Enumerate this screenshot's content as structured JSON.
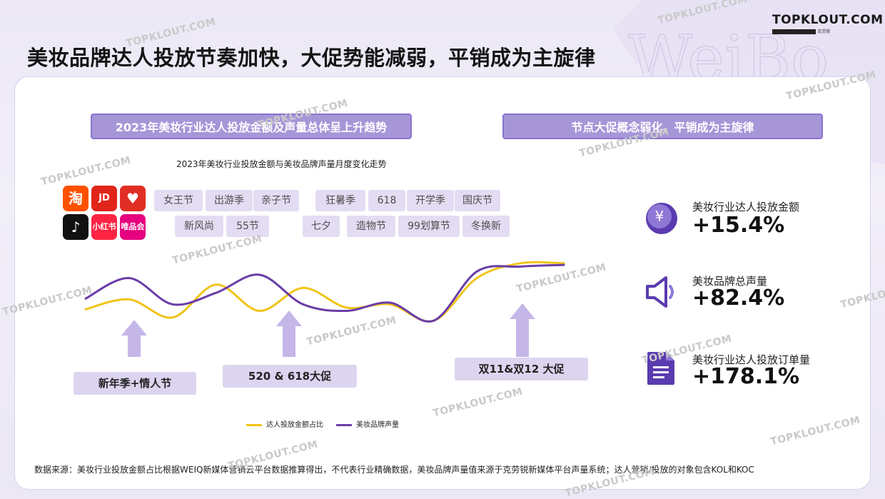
{
  "title": "美妆品牌达人投放节奏加快，大促势能减弱，平销成为主旋律",
  "brand": {
    "name": "TOPKLOUT.COM",
    "tagline": "克劳锐"
  },
  "watermark": "TOPKLOUT.COM",
  "left_banner": "2023年美妆行业达人投放金额及声量总体呈上升趋势",
  "right_banner": "节点大促概念弱化、平销成为主旋律",
  "chart_title": "2023年美妆行业投放金额与美妆品牌声量月度变化走势",
  "apps": [
    {
      "name": "taobao-icon",
      "label": "淘",
      "color": "#ff5000"
    },
    {
      "name": "jd-icon",
      "label": "JD",
      "color": "#e1251b"
    },
    {
      "name": "pinduoduo-icon",
      "label": "♥",
      "color": "#e02e24"
    },
    {
      "name": "douyin-icon",
      "label": "♪",
      "color": "#111111"
    },
    {
      "name": "xiaohongshu-icon",
      "label": "小红书",
      "color": "#ff2442"
    },
    {
      "name": "vipshop-icon",
      "label": "唯品会",
      "color": "#e5007f"
    }
  ],
  "tags_row1": [
    "女王节",
    "出游季",
    "亲子节",
    "狂暑季",
    "618",
    "开学季",
    "国庆节"
  ],
  "tags_row2": [
    "新风尚",
    "55节",
    "七夕",
    "造物节",
    "99划算节",
    "冬换新"
  ],
  "promos": [
    "新年季+情人节",
    "520 & 618大促",
    "双11&双12 大促"
  ],
  "chart_data": {
    "type": "line",
    "series": [
      {
        "name": "达人投放金额占比",
        "color": "#f0c419",
        "values": [
          0.32,
          0.44,
          0.22,
          0.62,
          0.3,
          0.58,
          0.34,
          0.38,
          0.18,
          0.7,
          0.88,
          0.88
        ]
      },
      {
        "name": "美妆品牌声量",
        "color": "#6a3da8",
        "values": [
          0.45,
          0.7,
          0.38,
          0.52,
          0.74,
          0.38,
          0.3,
          0.4,
          0.18,
          0.78,
          0.84,
          0.86
        ]
      }
    ]
  },
  "stats": [
    {
      "icon": "yuan-icon",
      "label": "美妆行业达人投放金额",
      "value": "+15.4%"
    },
    {
      "icon": "speaker-icon",
      "label": "美妆品牌总声量",
      "value": "+82.4%"
    },
    {
      "icon": "document-icon",
      "label": "美妆行业达人投放订单量",
      "value": "+178.1%"
    }
  ],
  "footnote": "数据来源：美妆行业投放金额占比根据WEIQ新媒体营销云平台数据推算得出，不代表行业精确数据，美妆品牌声量值来源于克劳锐新媒体平台声量系统；达人营销/投放的对象包含KOL和KOC"
}
